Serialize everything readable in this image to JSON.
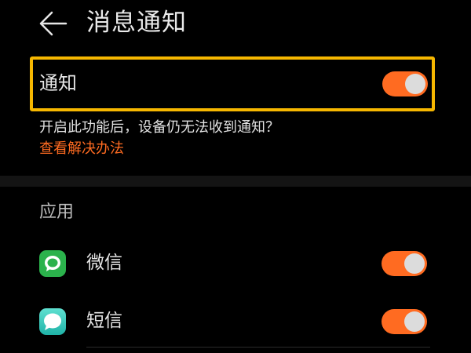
{
  "header": {
    "back_icon": "arrow-left-icon",
    "title": "消息通知"
  },
  "notification_toggle": {
    "label": "通知",
    "on": true,
    "highlight_color": "#f6b700"
  },
  "hint": {
    "text": "开启此功能后，设备仍无法收到通知？",
    "link_label": "查看解决办法"
  },
  "apps_section": {
    "title": "应用",
    "items": [
      {
        "label": "微信",
        "icon": "wechat-icon",
        "on": true
      },
      {
        "label": "短信",
        "icon": "messages-icon",
        "on": true
      }
    ]
  },
  "colors": {
    "accent": "#ff6b21",
    "background": "#000000",
    "text": "#e6e6e6"
  }
}
